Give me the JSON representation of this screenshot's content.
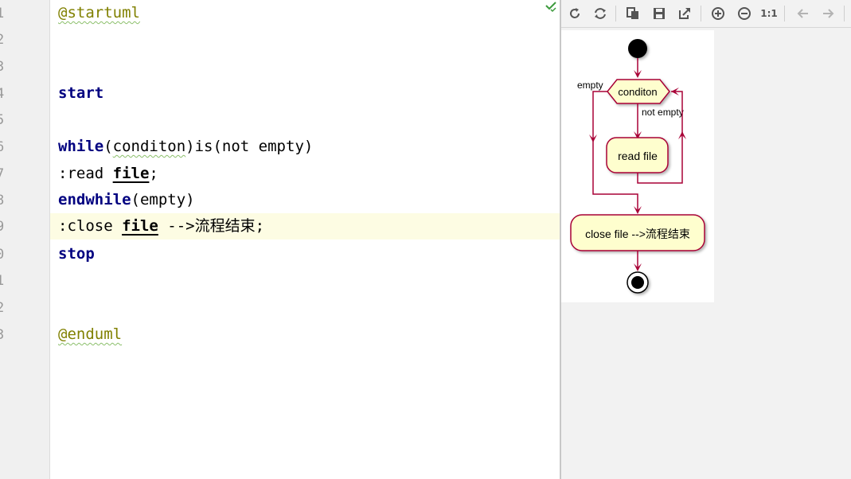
{
  "editor": {
    "line_numbers": [
      "1",
      "2",
      "3",
      "4",
      "5",
      "6",
      "7",
      "8",
      "9",
      "0",
      "1",
      "2",
      "3"
    ],
    "current_line_index": 8,
    "code": {
      "l1": "@startuml",
      "l4": "start",
      "l6_kw": "while",
      "l6_rest_a": "(",
      "l6_word": "conditon",
      "l6_rest_b": ")is(not empty)",
      "l7_a": ":read ",
      "l7_file": "file",
      "l7_b": ";",
      "l8_kw": "endwhile",
      "l8_rest": "(empty)",
      "l9_a": ":close ",
      "l9_file": "file",
      "l9_arrow": " -->",
      "l9_cjk": "流程结束",
      "l9_end": ";",
      "l10": "stop",
      "l13": "@enduml"
    },
    "status_icon": "check-icon"
  },
  "preview": {
    "toolbar": [
      {
        "name": "refresh-icon"
      },
      {
        "name": "sync-icon"
      },
      {
        "name": "copy-icon"
      },
      {
        "name": "save-icon"
      },
      {
        "name": "open-external-icon"
      },
      {
        "name": "zoom-in-icon"
      },
      {
        "name": "zoom-out-icon"
      },
      {
        "name": "actual-size-button",
        "label": "1:1"
      },
      {
        "name": "back-icon"
      },
      {
        "name": "forward-icon"
      }
    ],
    "diagram": {
      "decision_label": "conditon",
      "empty_label": "empty",
      "not_empty_label": "not empty",
      "read_label": "read file",
      "close_label": "close file -->流程结束",
      "colors": {
        "border": "#a80036",
        "fill": "#fefece",
        "text": "#000000",
        "node": "#000000"
      }
    }
  }
}
